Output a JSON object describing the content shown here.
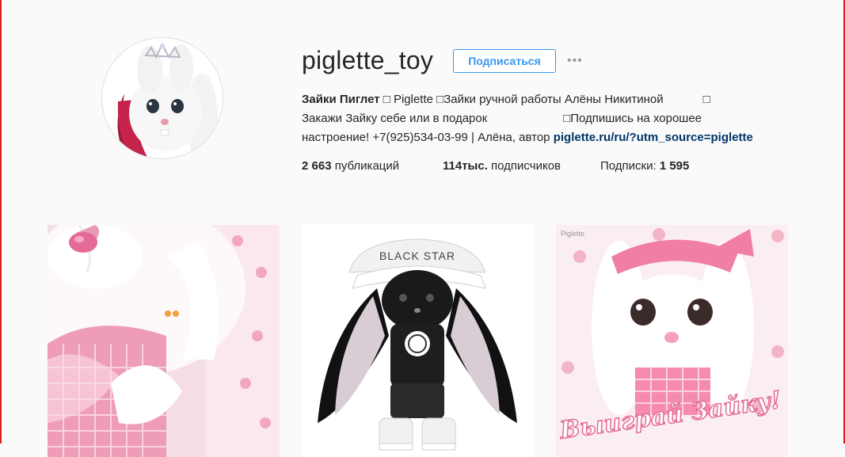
{
  "profile": {
    "username": "piglette_toy",
    "follow_label": "Подписаться",
    "more_label": "•••",
    "bio": {
      "name": "Зайки Пиглет",
      "line1_rest": " □ Piglette □Зайки ручной работы Алёны Никитиной            □",
      "line2": "Закажи Зайку себе или в подарок                       □Подпишись на хорошее",
      "line3_text": "настроение! +7(925)534-03-99 | Алёна, автор ",
      "link": "piglette.ru/ru/?utm_source=piglette"
    },
    "stats": {
      "posts_count": "2 663",
      "posts_label": " публикаций",
      "followers_count": "114тыс.",
      "followers_label": " подписчиков",
      "following_label": "Подписки: ",
      "following_count": "1 595"
    }
  },
  "posts": [
    {
      "alt": "pink bunny close-up",
      "caption": ""
    },
    {
      "cap_text": "BLACK STAR"
    },
    {
      "watermark": "Piglette",
      "caption": "Выиграй Зайку!"
    }
  ],
  "colors": {
    "accent": "#3897f0",
    "link": "#003569",
    "frame": "#e0201f"
  }
}
